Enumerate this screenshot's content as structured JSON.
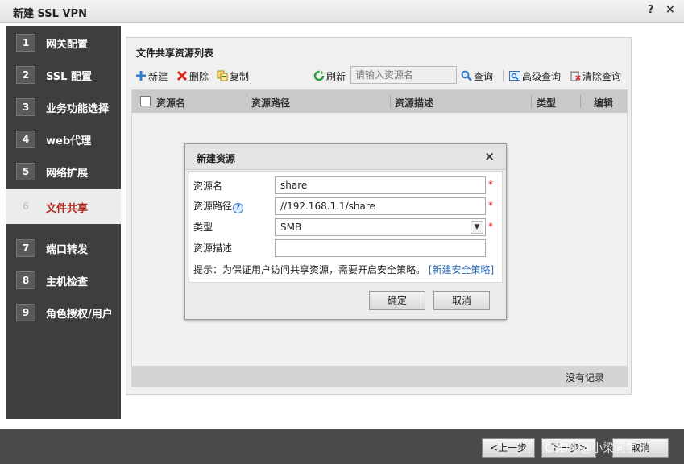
{
  "window": {
    "title": "新建 SSL VPN",
    "help": "?",
    "close": "×"
  },
  "steps": [
    {
      "num": "1",
      "label": "网关配置"
    },
    {
      "num": "2",
      "label": "SSL 配置"
    },
    {
      "num": "3",
      "label": "业务功能选择"
    },
    {
      "num": "4",
      "label": "web代理"
    },
    {
      "num": "5",
      "label": "网络扩展"
    },
    {
      "num": "6",
      "label": "文件共享",
      "active": true
    },
    {
      "num": "7",
      "label": "端口转发"
    },
    {
      "num": "8",
      "label": "主机检查"
    },
    {
      "num": "9",
      "label": "角色授权/用户"
    }
  ],
  "panel": {
    "title": "文件共享资源列表",
    "toolbar": {
      "new": "新建",
      "delete": "删除",
      "copy": "复制",
      "refresh": "刷新",
      "search_placeholder": "请输入资源名",
      "query": "查询",
      "advanced_query": "高级查询",
      "clear_query": "清除查询"
    },
    "columns": [
      "资源名",
      "资源路径",
      "资源描述",
      "类型",
      "编辑"
    ],
    "footer": "没有记录"
  },
  "dialog": {
    "title": "新建资源",
    "close": "×",
    "fields": {
      "name_label": "资源名",
      "name_value": "share",
      "path_label": "资源路径",
      "path_value": "//192.168.1.1/share",
      "type_label": "类型",
      "type_value": "SMB",
      "desc_label": "资源描述",
      "desc_value": ""
    },
    "required_mark": "*",
    "help_mark": "?",
    "hint_text": "提示：为保证用户访问共享资源，需要开启安全策略。",
    "hint_link": "[新建安全策略]",
    "ok": "确定",
    "cancel": "取消"
  },
  "bottom": {
    "prev": "<上一步",
    "next": "下一步>",
    "cancel": "取消",
    "watermark": "CSDN @小梁同学"
  },
  "colors": {
    "active_step_text": "#b3261e",
    "link": "#2b6fbf",
    "required": "#dd1111"
  }
}
